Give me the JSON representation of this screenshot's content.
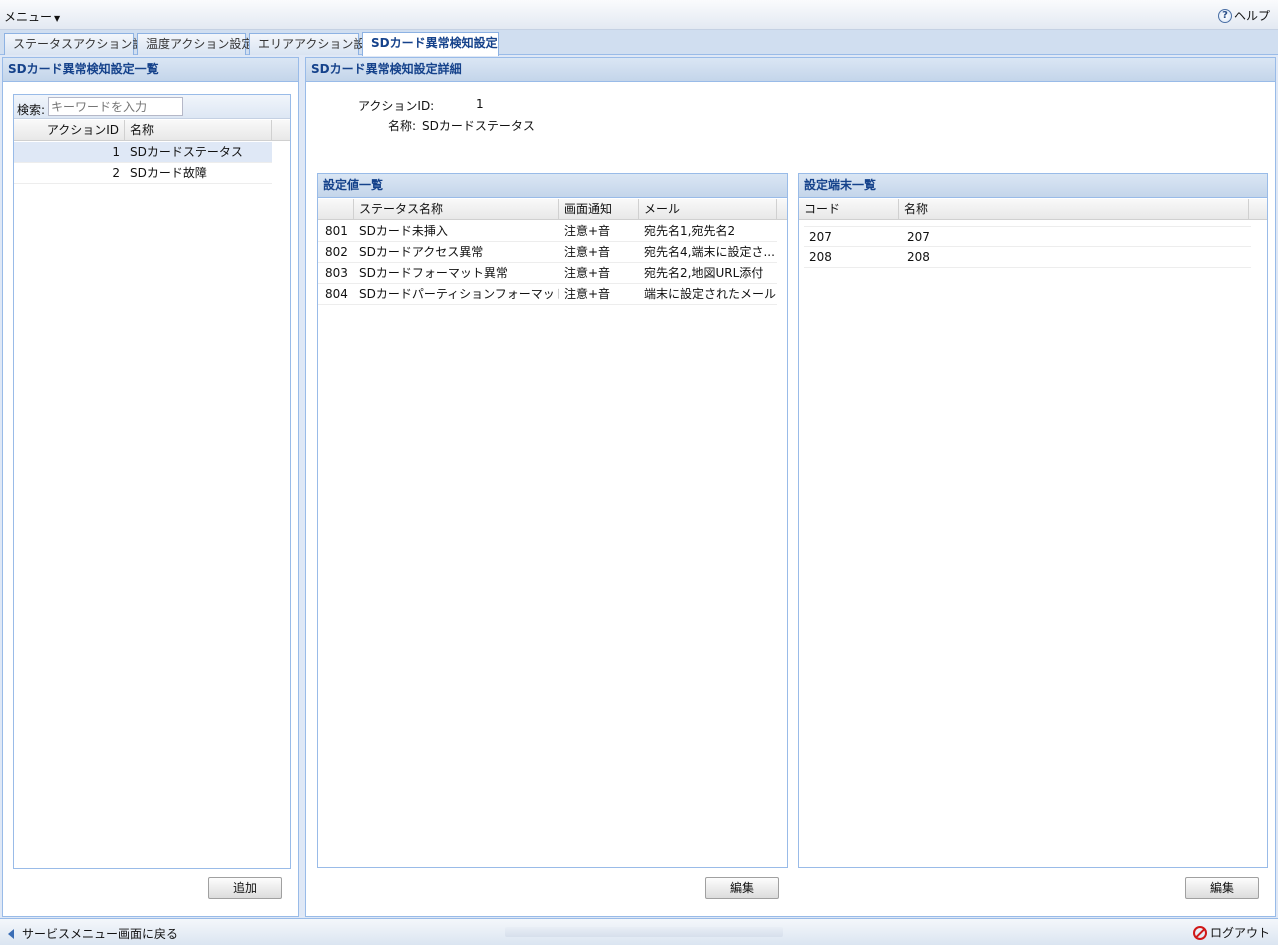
{
  "menu": {
    "label": "メニュー"
  },
  "help": {
    "label": "ヘルプ"
  },
  "tabs": [
    {
      "label": "ステータスアクション設定"
    },
    {
      "label": "温度アクション設定"
    },
    {
      "label": "エリアアクション設定"
    },
    {
      "label": "SDカード異常検知設定"
    }
  ],
  "left_panel": {
    "title": "SDカード異常検知設定一覧",
    "search_label": "検索:",
    "search_placeholder": "キーワードを入力",
    "columns": [
      "アクションID",
      "名称"
    ],
    "rows": [
      {
        "id": "1",
        "name": "SDカードステータス"
      },
      {
        "id": "2",
        "name": "SDカード故障"
      }
    ],
    "add_label": "追加"
  },
  "detail": {
    "title": "SDカード異常検知設定詳細",
    "action_id_label": "アクションID:",
    "action_id_value": "1",
    "name_label": "名称:",
    "name_value": "SDカードステータス"
  },
  "settings_list": {
    "title": "設定値一覧",
    "columns": [
      "",
      "ステータス名称",
      "画面通知",
      "メール"
    ],
    "rows": [
      {
        "code": "801",
        "status": "SDカード未挿入",
        "notify": "注意+音",
        "mail": "宛先名1,宛先名2"
      },
      {
        "code": "802",
        "status": "SDカードアクセス異常",
        "notify": "注意+音",
        "mail": "宛先名4,端末に設定さ..."
      },
      {
        "code": "803",
        "status": "SDカードフォーマット異常",
        "notify": "注意+音",
        "mail": "宛先名2,地図URL添付"
      },
      {
        "code": "804",
        "status": "SDカードパーティションフォーマット誤り",
        "notify": "注意+音",
        "mail": "端末に設定されたメール..."
      }
    ],
    "edit_label": "編集"
  },
  "terminals_list": {
    "title": "設定端末一覧",
    "columns": [
      "コード",
      "名称"
    ],
    "rows": [
      {
        "code": "207",
        "name": "207"
      },
      {
        "code": "208",
        "name": "208"
      }
    ],
    "edit_label": "編集"
  },
  "footer": {
    "back_label": "サービスメニュー画面に戻る",
    "logout_label": "ログアウト"
  }
}
